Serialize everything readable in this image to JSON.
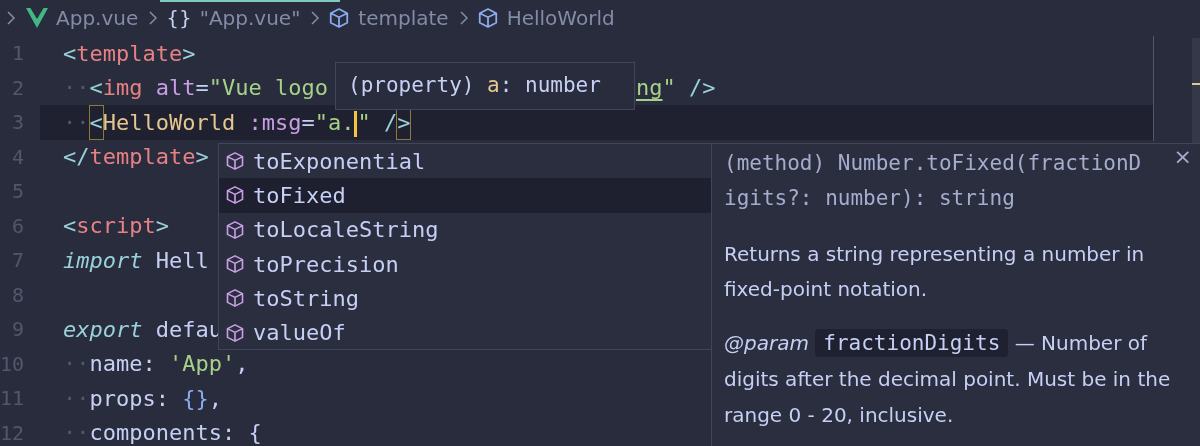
{
  "breadcrumb": {
    "items": [
      {
        "kind": "file",
        "label": "App.vue"
      },
      {
        "kind": "object",
        "icon_text": "{}",
        "label": "\"App.vue\""
      },
      {
        "kind": "element",
        "label": "template"
      },
      {
        "kind": "element",
        "label": "HelloWorld"
      }
    ]
  },
  "editor": {
    "lines": [
      {
        "number": "1",
        "current": false,
        "tokens": [
          {
            "text": "<",
            "kind": "punct"
          },
          {
            "text": "template",
            "kind": "tag"
          },
          {
            "text": ">",
            "kind": "punct"
          }
        ]
      },
      {
        "number": "2",
        "current": false,
        "tokens": [
          {
            "text": "··",
            "kind": "ws"
          },
          {
            "text": "<",
            "kind": "punct"
          },
          {
            "text": "img",
            "kind": "tag"
          },
          {
            "text": " alt",
            "kind": "attr"
          },
          {
            "text": "=",
            "kind": "plain"
          },
          {
            "text": "\"Vue logo",
            "kind": "str"
          },
          {
            "text": "ng",
            "kind": "str",
            "underline": true,
            "after_overlay": true
          },
          {
            "text": "\" ",
            "kind": "str",
            "after_overlay": true
          },
          {
            "text": "/>",
            "kind": "punct",
            "after_overlay": true
          }
        ]
      },
      {
        "number": "3",
        "current": true,
        "tokens": [
          {
            "text": "··",
            "kind": "ws"
          },
          {
            "text": "<",
            "kind": "punct",
            "bracket_match": true
          },
          {
            "text": "HelloWorld",
            "kind": "comp"
          },
          {
            "text": " :msg",
            "kind": "attr"
          },
          {
            "text": "=",
            "kind": "plain"
          },
          {
            "text": "\"a.",
            "kind": "str",
            "cursor_after": true
          },
          {
            "text": "\"",
            "kind": "str"
          },
          {
            "text": " /",
            "kind": "punct"
          },
          {
            "text": ">",
            "kind": "punct",
            "bracket_match": true
          }
        ]
      },
      {
        "number": "4",
        "current": false,
        "tokens": [
          {
            "text": "</",
            "kind": "punct"
          },
          {
            "text": "template",
            "kind": "tag"
          },
          {
            "text": ">",
            "kind": "punct"
          }
        ]
      },
      {
        "number": "5",
        "current": false
      },
      {
        "number": "6",
        "current": false,
        "tokens": [
          {
            "text": "<",
            "kind": "punct"
          },
          {
            "text": "script",
            "kind": "tag"
          },
          {
            "text": ">",
            "kind": "punct"
          }
        ]
      },
      {
        "number": "7",
        "current": false,
        "tokens": [
          {
            "text": "import",
            "kind": "kw"
          },
          {
            "text": " Hell",
            "kind": "plain"
          }
        ]
      },
      {
        "number": "8",
        "current": false
      },
      {
        "number": "9",
        "current": false,
        "tokens": [
          {
            "text": "export",
            "kind": "kw"
          },
          {
            "text": " defau",
            "kind": "plain"
          }
        ]
      },
      {
        "number": "10",
        "current": false,
        "tokens": [
          {
            "text": "··",
            "kind": "ws"
          },
          {
            "text": "name: ",
            "kind": "plain"
          },
          {
            "text": "'App'",
            "kind": "str"
          },
          {
            "text": ",",
            "kind": "plain"
          }
        ]
      },
      {
        "number": "11",
        "current": false,
        "tokens": [
          {
            "text": "··",
            "kind": "ws"
          },
          {
            "text": "props: ",
            "kind": "plain"
          },
          {
            "text": "{}",
            "kind": "brace"
          },
          {
            "text": ",",
            "kind": "plain"
          }
        ]
      },
      {
        "number": "12",
        "current": false,
        "tokens": [
          {
            "text": "··",
            "kind": "ws"
          },
          {
            "text": "components: {",
            "kind": "plain"
          }
        ]
      }
    ]
  },
  "hover": {
    "tokens": [
      {
        "text": "(property) ",
        "kind": "plain"
      },
      {
        "text": "a",
        "kind": "comp"
      },
      {
        "text": ": number",
        "kind": "plain"
      }
    ]
  },
  "suggestions": {
    "items": [
      {
        "label": "toExponential",
        "selected": false
      },
      {
        "label": "toFixed",
        "selected": true
      },
      {
        "label": "toLocaleString",
        "selected": false
      },
      {
        "label": "toPrecision",
        "selected": false
      },
      {
        "label": "toString",
        "selected": false
      },
      {
        "label": "valueOf",
        "selected": false
      }
    ]
  },
  "details": {
    "signature": "(method) Number.toFixed(fractionDigits?: number): string",
    "description": "Returns a string representing a number in fixed-point notation.",
    "param_tag": "@param",
    "param_name": "fractionDigits",
    "param_description": "— Number of digits after the decimal point. Must be in the range 0 - 20, inclusive.",
    "close": "×"
  }
}
